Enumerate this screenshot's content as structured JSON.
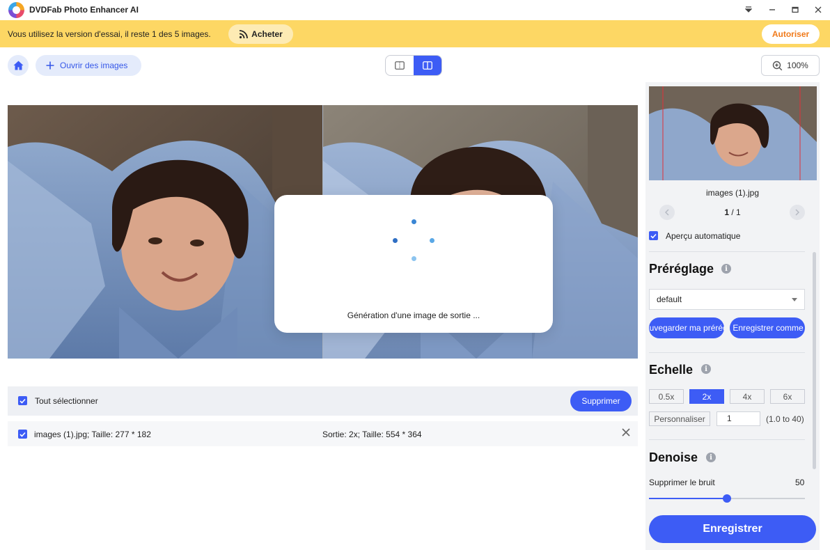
{
  "app": {
    "title": "DVDFab Photo Enhancer AI"
  },
  "window": {
    "menu_icon": "caret-down-icon",
    "minimize_icon": "minimize-icon",
    "maximize_icon": "maximize-icon",
    "close_icon": "close-icon"
  },
  "trial": {
    "message": "Vous utilisez la version d'essai, il reste 1 des 5 images.",
    "buy_label": "Acheter",
    "authorize_label": "Autoriser"
  },
  "toolbar": {
    "open_label": "Ouvrir des images",
    "zoom": "100%"
  },
  "loading": {
    "text": "Génération d'une image de sortie ..."
  },
  "file_list": {
    "select_all_label": "Tout sélectionner",
    "delete_label": "Supprimer",
    "items": [
      {
        "name": "images (1).jpg; Taille: 277 * 182",
        "output": "Sortie: 2x; Taille: 554 * 364"
      }
    ]
  },
  "sidebar": {
    "thumb_name": "images (1).jpg",
    "page_current": "1",
    "page_total": " / 1",
    "auto_preview_label": "Aperçu automatique",
    "preset": {
      "title": "Préréglage",
      "selected": "default",
      "save_preset_label": "Sauvegarder ma préréglage",
      "save_as_label": "Enregistrer comme"
    },
    "scale": {
      "title": "Echelle",
      "options": [
        "0.5x",
        "2x",
        "4x",
        "6x"
      ],
      "selected": "2x",
      "custom_label": "Personnaliser",
      "custom_value": "1",
      "range_hint": "(1.0 to 40)"
    },
    "denoise": {
      "title": "Denoise",
      "label": "Supprimer le bruit",
      "value": "50",
      "fraction": 0.5
    },
    "save_label": "Enregistrer"
  },
  "colors": {
    "accent": "#3d5cf5",
    "trial_bar": "#fdd764",
    "authorize_text": "#f07a1a"
  }
}
